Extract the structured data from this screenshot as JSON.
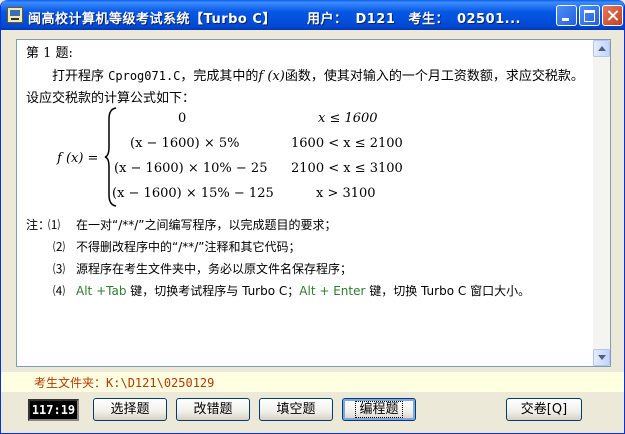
{
  "window": {
    "title": "闽高校计算机等级考试系统【Turbo C】",
    "user_label": "用户：",
    "user_value": "D121",
    "examinee_label": "考生：",
    "examinee_value": "02501..."
  },
  "question": {
    "heading": "第 1 题:",
    "intro_pre": "打开程序 ",
    "program": "Cprog071.C",
    "intro_mid": "，完成其中的",
    "fx": "f (x)",
    "intro_post": "函数，使其对输入的一个月工资数额，求应交税款。设应交税款的计算公式如下：",
    "formula_lhs": "f (x) =",
    "cases": [
      {
        "expr": "0",
        "cond": "x ≤ 1600"
      },
      {
        "expr": "(x − 1600) × 5%",
        "cond": "1600 < x ≤ 2100"
      },
      {
        "expr": "(x − 1600) × 10% − 25",
        "cond": "2100 < x ≤ 3100"
      },
      {
        "expr": "(x − 1600) × 15% − 125",
        "cond": "x > 3100"
      }
    ]
  },
  "notes": {
    "label": "注：",
    "items": [
      {
        "num": "⑴",
        "text": "在一对“/**/”之间编写程序，以完成题目的要求；"
      },
      {
        "num": "⑵",
        "text": "不得删改程序中的“/**/”注释和其它代码；"
      },
      {
        "num": "⑶",
        "text": "源程序在考生文件夹中，务必以原文件名保存程序；"
      },
      {
        "num": "⑷",
        "k1": "Alt +Tab",
        "t1": " 键，切换考试程序与 Turbo C；",
        "k2": "Alt + Enter",
        "t2": " 键，切换 Turbo C 窗口大小。"
      }
    ]
  },
  "folder": {
    "label": "考生文件夹：",
    "path": "K:\\D121\\0250129"
  },
  "timer": "117:19",
  "buttons": {
    "choice": "选择题",
    "fix": "改错题",
    "fill": "填空题",
    "program": "编程题",
    "submit": "交卷[Q]"
  },
  "colors": {
    "title_bar": "#0558E4",
    "key_green": "#2E7D32",
    "folder_text": "#B03A00",
    "timer_bg": "#000000"
  }
}
